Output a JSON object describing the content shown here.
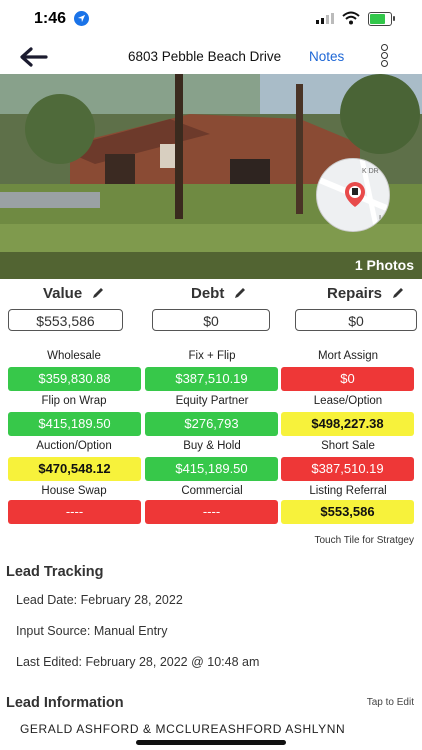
{
  "status_bar": {
    "time": "1:46"
  },
  "header": {
    "address": "6803 Pebble Beach Drive",
    "notes_label": "Notes"
  },
  "photo": {
    "count_label": "1 Photos",
    "map_legal": "Legal"
  },
  "valuation": {
    "value_label": "Value",
    "value": "$553,586",
    "debt_label": "Debt",
    "debt": "$0",
    "repairs_label": "Repairs",
    "repairs": "$0"
  },
  "tiles": [
    {
      "label": "Wholesale",
      "value": "$359,830.88",
      "color": "green"
    },
    {
      "label": "Fix + Flip",
      "value": "$387,510.19",
      "color": "green"
    },
    {
      "label": "Mort Assign",
      "value": "$0",
      "color": "red"
    },
    {
      "label": "Flip on Wrap",
      "value": "$415,189.50",
      "color": "green"
    },
    {
      "label": "Equity Partner",
      "value": "$276,793",
      "color": "green"
    },
    {
      "label": "Lease/Option",
      "value": "$498,227.38",
      "color": "yellow"
    },
    {
      "label": "Auction/Option",
      "value": "$470,548.12",
      "color": "yellow"
    },
    {
      "label": "Buy & Hold",
      "value": "$415,189.50",
      "color": "green"
    },
    {
      "label": "Short Sale",
      "value": "$387,510.19",
      "color": "red"
    },
    {
      "label": "House Swap",
      "value": "----",
      "color": "red"
    },
    {
      "label": "Commercial",
      "value": "----",
      "color": "red"
    },
    {
      "label": "Listing Referral",
      "value": "$553,586",
      "color": "yellow"
    }
  ],
  "tile_hint": "Touch Tile for Stratgey",
  "lead_tracking": {
    "title": "Lead Tracking",
    "lead_date": "Lead Date: February 28, 2022",
    "input_source": "Input Source: Manual Entry",
    "last_edited": "Last Edited: February 28, 2022 @ 10:48 am"
  },
  "lead_information": {
    "title": "Lead Information",
    "tap_to_edit": "Tap to Edit",
    "names": "GERALD  ASHFORD  & MCCLUREASHFORD  ASHLYNN"
  },
  "colors": {
    "green": "#37c84a",
    "red": "#ee3737",
    "yellow": "#f7f23b",
    "link": "#1e67d6"
  }
}
